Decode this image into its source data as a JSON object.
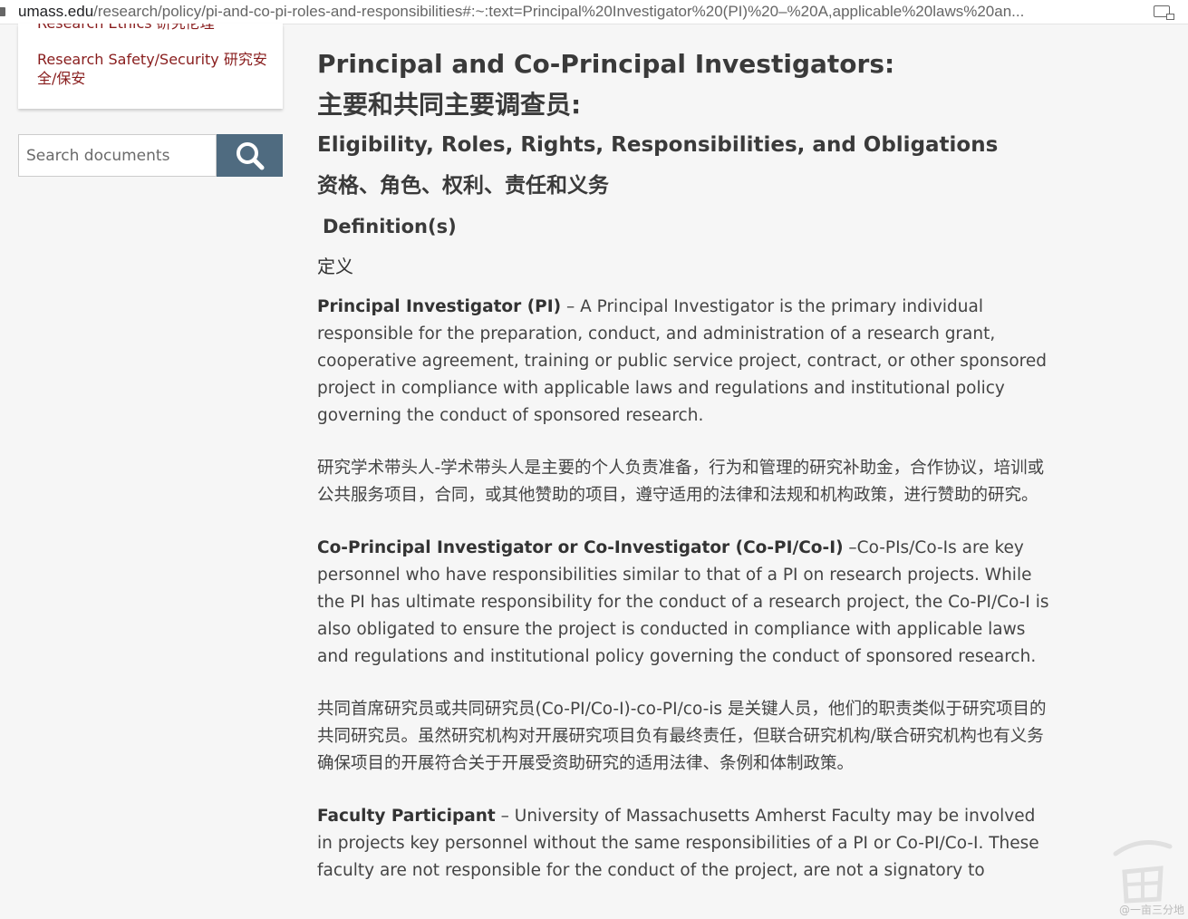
{
  "browser": {
    "url_host": "umass.edu",
    "url_path": "/research/policy/pi-and-co-pi-roles-and-responsibilities#:~:text=Principal%20Investigator%20(PI)%20–%20A,applicable%20laws%20an..."
  },
  "sidebar": {
    "cut_item_label": "Research Ethics 研究伦理",
    "item_label": "Research Safety/Security 研究安全/保安",
    "search_placeholder": "Search documents",
    "link_color": "#881c1c",
    "search_button_color": "#4f6b80"
  },
  "main": {
    "title_en": "Principal and Co-Principal Investigators:",
    "title_zh": "主要和共同主要调查员:",
    "subtitle_en": "Eligibility, Roles, Rights, Responsibilities, and Obligations",
    "subtitle_zh": "资格、角色、权利、责任和义务",
    "definitions_heading": "Definition(s)",
    "definitions_heading_zh": "定义",
    "pi_term": "Principal Investigator (PI)",
    "pi_text": " – A Principal Investigator is the primary individual responsible for the preparation, conduct, and administration of a research grant, cooperative agreement, training or public service project, contract, or other sponsored project in compliance with applicable laws and regulations and institutional policy governing the conduct of sponsored research.",
    "pi_text_zh": "研究学术带头人-学术带头人是主要的个人负责准备，行为和管理的研究补助金，合作协议，培训或公共服务项目，合同，或其他赞助的项目，遵守适用的法律和法规和机构政策，进行赞助的研究。",
    "copi_term": "Co-Principal Investigator or Co-Investigator (Co-PI/Co-I)",
    "copi_text": " –Co-PIs/Co-Is are key personnel who have responsibilities similar to that of a PI on research projects.  While the PI has ultimate responsibility for the conduct of a research project, the Co-PI/Co-I is also obligated to ensure the project is conducted in compliance with applicable laws and regulations and institutional policy governing the conduct of sponsored research.",
    "copi_text_zh": "共同首席研究员或共同研究员(Co-PI/Co-I)-co-PI/co-is 是关键人员，他们的职责类似于研究项目的共同研究员。虽然研究机构对开展研究项目负有最终责任，但联合研究机构/联合研究机构也有义务确保项目的开展符合关于开展受资助研究的适用法律、条例和体制政策。",
    "faculty_term": "Faculty Participant",
    "faculty_text": " – University of Massachusetts Amherst Faculty may be involved in projects key personnel without the same responsibilities of a PI or Co-PI/Co-I. These faculty are not responsible for the conduct of the project, are not a signatory to"
  },
  "watermark": {
    "text": "@一亩三分地"
  }
}
